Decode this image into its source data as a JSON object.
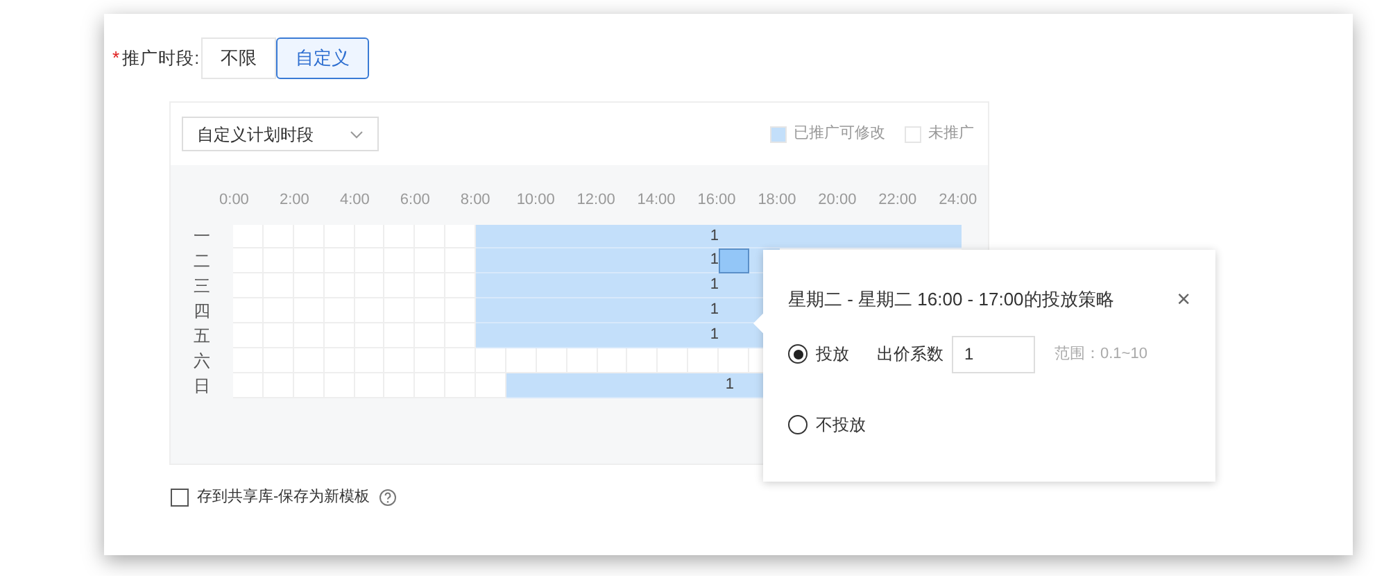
{
  "field": {
    "required_mark": "*",
    "label": "推广时段:",
    "options": [
      {
        "label": "不限",
        "selected": false
      },
      {
        "label": "自定义",
        "selected": true
      }
    ]
  },
  "panel": {
    "plan_select": {
      "value": "自定义计划时段"
    },
    "legend": [
      {
        "label": "已推广可修改",
        "color": "#c3dffa"
      },
      {
        "label": "未推广",
        "color": "#ffffff"
      }
    ],
    "hours": [
      "0:00",
      "2:00",
      "4:00",
      "6:00",
      "8:00",
      "10:00",
      "12:00",
      "14:00",
      "16:00",
      "18:00",
      "20:00",
      "22:00",
      "24:00"
    ],
    "days": [
      {
        "label": "一",
        "value": "1",
        "cells": [
          {
            "on": false,
            "selected": false
          },
          {
            "on": false,
            "selected": false
          },
          {
            "on": false,
            "selected": false
          },
          {
            "on": false,
            "selected": false
          },
          {
            "on": false,
            "selected": false
          },
          {
            "on": false,
            "selected": false
          },
          {
            "on": false,
            "selected": false
          },
          {
            "on": false,
            "selected": false
          },
          {
            "on": true,
            "selected": false
          },
          {
            "on": true,
            "selected": false
          },
          {
            "on": true,
            "selected": false
          },
          {
            "on": true,
            "selected": false
          },
          {
            "on": true,
            "selected": false
          },
          {
            "on": true,
            "selected": false
          },
          {
            "on": true,
            "selected": false
          },
          {
            "on": true,
            "selected": false
          },
          {
            "on": true,
            "selected": false
          },
          {
            "on": true,
            "selected": false
          },
          {
            "on": true,
            "selected": false
          },
          {
            "on": true,
            "selected": false
          },
          {
            "on": true,
            "selected": false
          },
          {
            "on": true,
            "selected": false
          },
          {
            "on": true,
            "selected": false
          },
          {
            "on": true,
            "selected": false
          }
        ]
      },
      {
        "label": "二",
        "value": "1",
        "cells": [
          {
            "on": false,
            "selected": false
          },
          {
            "on": false,
            "selected": false
          },
          {
            "on": false,
            "selected": false
          },
          {
            "on": false,
            "selected": false
          },
          {
            "on": false,
            "selected": false
          },
          {
            "on": false,
            "selected": false
          },
          {
            "on": false,
            "selected": false
          },
          {
            "on": false,
            "selected": false
          },
          {
            "on": true,
            "selected": false
          },
          {
            "on": true,
            "selected": false
          },
          {
            "on": true,
            "selected": false
          },
          {
            "on": true,
            "selected": false
          },
          {
            "on": true,
            "selected": false
          },
          {
            "on": true,
            "selected": false
          },
          {
            "on": true,
            "selected": false
          },
          {
            "on": true,
            "selected": false
          },
          {
            "on": true,
            "selected": true
          },
          {
            "on": true,
            "selected": false
          }
        ]
      },
      {
        "label": "三",
        "value": "1",
        "cells": [
          {
            "on": false,
            "selected": false
          },
          {
            "on": false,
            "selected": false
          },
          {
            "on": false,
            "selected": false
          },
          {
            "on": false,
            "selected": false
          },
          {
            "on": false,
            "selected": false
          },
          {
            "on": false,
            "selected": false
          },
          {
            "on": false,
            "selected": false
          },
          {
            "on": false,
            "selected": false
          },
          {
            "on": true,
            "selected": false
          },
          {
            "on": true,
            "selected": false
          },
          {
            "on": true,
            "selected": false
          },
          {
            "on": true,
            "selected": false
          },
          {
            "on": true,
            "selected": false
          },
          {
            "on": true,
            "selected": false
          },
          {
            "on": true,
            "selected": false
          },
          {
            "on": true,
            "selected": false
          },
          {
            "on": true,
            "selected": false
          },
          {
            "on": true,
            "selected": false
          }
        ]
      },
      {
        "label": "四",
        "value": "1",
        "cells": [
          {
            "on": false,
            "selected": false
          },
          {
            "on": false,
            "selected": false
          },
          {
            "on": false,
            "selected": false
          },
          {
            "on": false,
            "selected": false
          },
          {
            "on": false,
            "selected": false
          },
          {
            "on": false,
            "selected": false
          },
          {
            "on": false,
            "selected": false
          },
          {
            "on": false,
            "selected": false
          },
          {
            "on": true,
            "selected": false
          },
          {
            "on": true,
            "selected": false
          },
          {
            "on": true,
            "selected": false
          },
          {
            "on": true,
            "selected": false
          },
          {
            "on": true,
            "selected": false
          },
          {
            "on": true,
            "selected": false
          },
          {
            "on": true,
            "selected": false
          },
          {
            "on": true,
            "selected": false
          },
          {
            "on": true,
            "selected": false
          },
          {
            "on": true,
            "selected": false
          }
        ]
      },
      {
        "label": "五",
        "value": "1",
        "cells": [
          {
            "on": false,
            "selected": false
          },
          {
            "on": false,
            "selected": false
          },
          {
            "on": false,
            "selected": false
          },
          {
            "on": false,
            "selected": false
          },
          {
            "on": false,
            "selected": false
          },
          {
            "on": false,
            "selected": false
          },
          {
            "on": false,
            "selected": false
          },
          {
            "on": false,
            "selected": false
          },
          {
            "on": true,
            "selected": false
          },
          {
            "on": true,
            "selected": false
          },
          {
            "on": true,
            "selected": false
          },
          {
            "on": true,
            "selected": false
          },
          {
            "on": true,
            "selected": false
          },
          {
            "on": true,
            "selected": false
          },
          {
            "on": true,
            "selected": false
          },
          {
            "on": true,
            "selected": false
          },
          {
            "on": true,
            "selected": false
          },
          {
            "on": true,
            "selected": false
          }
        ]
      },
      {
        "label": "六",
        "cells": [
          {
            "on": false,
            "selected": false
          },
          {
            "on": false,
            "selected": false
          },
          {
            "on": false,
            "selected": false
          },
          {
            "on": false,
            "selected": false
          },
          {
            "on": false,
            "selected": false
          },
          {
            "on": false,
            "selected": false
          },
          {
            "on": false,
            "selected": false
          },
          {
            "on": false,
            "selected": false
          },
          {
            "on": false,
            "selected": false
          },
          {
            "on": false,
            "selected": false
          },
          {
            "on": false,
            "selected": false
          },
          {
            "on": false,
            "selected": false
          },
          {
            "on": false,
            "selected": false
          },
          {
            "on": false,
            "selected": false
          },
          {
            "on": false,
            "selected": false
          },
          {
            "on": false,
            "selected": false
          },
          {
            "on": false,
            "selected": false
          },
          {
            "on": false,
            "selected": false
          }
        ]
      },
      {
        "label": "日",
        "value": "1",
        "cells": [
          {
            "on": false,
            "selected": false
          },
          {
            "on": false,
            "selected": false
          },
          {
            "on": false,
            "selected": false
          },
          {
            "on": false,
            "selected": false
          },
          {
            "on": false,
            "selected": false
          },
          {
            "on": false,
            "selected": false
          },
          {
            "on": false,
            "selected": false
          },
          {
            "on": false,
            "selected": false
          },
          {
            "on": false,
            "selected": false
          },
          {
            "on": true,
            "selected": false
          },
          {
            "on": true,
            "selected": false
          },
          {
            "on": true,
            "selected": false
          },
          {
            "on": true,
            "selected": false
          },
          {
            "on": true,
            "selected": false
          },
          {
            "on": true,
            "selected": false
          },
          {
            "on": true,
            "selected": false
          },
          {
            "on": true,
            "selected": false
          },
          {
            "on": true,
            "selected": false
          }
        ]
      }
    ]
  },
  "popover": {
    "title": "星期二 - 星期二 16:00 - 17:00的投放策略",
    "close": "×",
    "options": [
      {
        "label": "投放",
        "selected": true,
        "bid_label": "出价系数",
        "bid_value": "1",
        "hint": "范围：0.1~10"
      },
      {
        "label": "不投放",
        "selected": false
      }
    ]
  },
  "save_template": {
    "label": "存到共享库-保存为新模板",
    "checked": false
  }
}
